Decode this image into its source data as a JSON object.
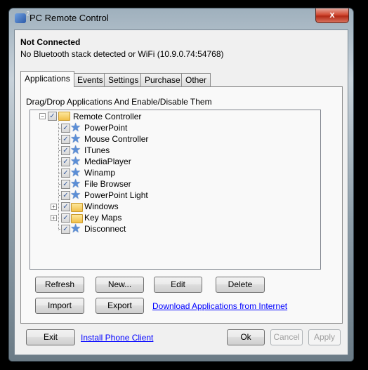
{
  "window": {
    "title": "PC Remote Control",
    "close_label": "x"
  },
  "status": {
    "title": "Not Connected",
    "detail": "No Bluetooth stack detected or WiFi (10.9.0.74:54768)"
  },
  "tabs": [
    {
      "label": "Applications",
      "active": true
    },
    {
      "label": "Events"
    },
    {
      "label": "Settings"
    },
    {
      "label": "Purchase"
    },
    {
      "label": "Other"
    }
  ],
  "panel": {
    "label": "Drag/Drop Applications And Enable/Disable Them",
    "tree": {
      "root": {
        "label": "Remote Controller",
        "checked": true,
        "expanded": true,
        "icon": "folder-icon"
      },
      "children": [
        {
          "label": "PowerPoint",
          "checked": true,
          "icon": "star-icon"
        },
        {
          "label": "Mouse Controller",
          "checked": true,
          "icon": "star-icon"
        },
        {
          "label": "ITunes",
          "checked": true,
          "icon": "star-icon"
        },
        {
          "label": "MediaPlayer",
          "checked": true,
          "icon": "star-icon"
        },
        {
          "label": "Winamp",
          "checked": true,
          "icon": "star-icon"
        },
        {
          "label": "File Browser",
          "checked": true,
          "icon": "star-icon"
        },
        {
          "label": "PowerPoint Light",
          "checked": true,
          "icon": "star-icon"
        },
        {
          "label": "Windows",
          "checked": true,
          "icon": "folder-icon",
          "expandable": true
        },
        {
          "label": "Key Maps",
          "checked": true,
          "icon": "folder-icon",
          "expandable": true
        },
        {
          "label": "Disconnect",
          "checked": true,
          "icon": "star-icon"
        }
      ]
    },
    "buttons": {
      "refresh": "Refresh",
      "new": "New...",
      "edit": "Edit",
      "delete": "Delete",
      "import": "Import",
      "export": "Export"
    },
    "download_link": "Download Applications from Internet"
  },
  "footer": {
    "exit": "Exit",
    "install_link": "Install Phone Client",
    "ok": "Ok",
    "cancel": "Cancel",
    "apply": "Apply"
  }
}
